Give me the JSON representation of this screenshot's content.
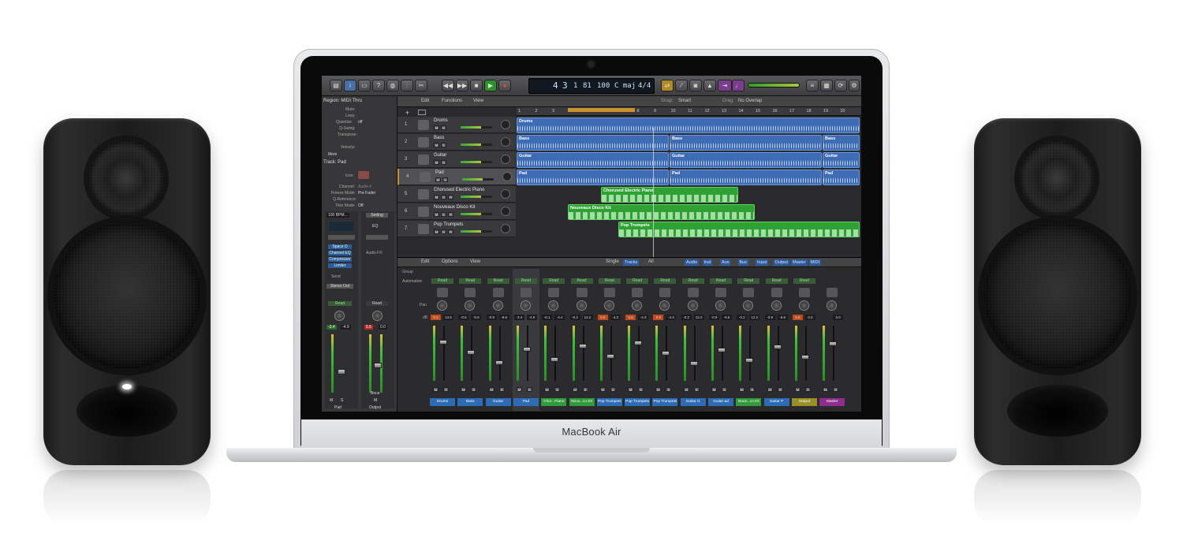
{
  "device": {
    "brand": "MacBook Air"
  },
  "app": {
    "lcd": {
      "bar": "4",
      "beat": "3",
      "div": "1",
      "tick": "81",
      "tempo": "100",
      "key": "C maj",
      "sig": "4/4"
    },
    "inspector": {
      "region_title": "Region: MIDI Thru",
      "rows": [
        "Mute:",
        "Loop:",
        "Quantize",
        "Q-Swing:",
        "Transpose:",
        "Velocity:"
      ],
      "quantize_value": "off",
      "more": "More",
      "track_title": "Track: Pad",
      "track_rows": [
        "Icon:",
        "Channel:",
        "Freeze Mode:",
        "Q-Reference:",
        "Flex Mode:"
      ],
      "channel_value": "Audio 4",
      "freeze_value": "Pre Fader",
      "flex_value": "Off",
      "tempo_label": "100 BPM...",
      "setting": "Setting",
      "eq": "EQ",
      "plugins": [
        "Space D",
        "Channel EQ",
        "Compressor",
        "Limiter"
      ],
      "audio_fx": "Audio FX",
      "send": "Send",
      "stereo_out": "Stereo Out",
      "read_a": "Read",
      "read_b": "Read",
      "vals_a": [
        "-3.4",
        "-4.9"
      ],
      "vals_b": [
        "5.5",
        "0.0"
      ],
      "bnce": "Bnce",
      "strip_names": [
        "Pad",
        "Output"
      ]
    },
    "tracks_toolbar": {
      "edit": "Edit",
      "functions": "Functions",
      "view": "View",
      "snap_label": "Snap:",
      "snap": "Smart",
      "drag_label": "Drag:",
      "drag": "No Overlap"
    },
    "ruler": [
      "1",
      "2",
      "3",
      "4",
      "5",
      "6",
      "7",
      "8",
      "9",
      "10",
      "11",
      "12",
      "13",
      "14",
      "15",
      "16",
      "17",
      "18",
      "19",
      "20"
    ],
    "tracks": [
      {
        "num": "1",
        "name": "Drums"
      },
      {
        "num": "2",
        "name": "Bass"
      },
      {
        "num": "3",
        "name": "Guitar"
      },
      {
        "num": "4",
        "name": "Pad"
      },
      {
        "num": "5",
        "name": "Chorused Electric Piano"
      },
      {
        "num": "6",
        "name": "Nouveaux Disco Kit"
      },
      {
        "num": "7",
        "name": "Pop Trumpets"
      }
    ],
    "ms": {
      "m": "M",
      "s": "S",
      "r": "R"
    },
    "regions": {
      "drums": "Drums",
      "bass": "Bass",
      "guitar": "Guitar",
      "pad": "Pad",
      "epiano": "Chorused Electric Piano",
      "disco": "Nouveaux Disco Kit",
      "trumpets": "Pop Trumpets"
    },
    "mixer_toolbar": {
      "edit": "Edit",
      "options": "Options",
      "view": "View",
      "single": "Single",
      "tracks": "Tracks",
      "all": "All",
      "filters": [
        "Audio",
        "Inst",
        "Aux",
        "Bus",
        "Input",
        "Output",
        "Master",
        "MIDI"
      ]
    },
    "mixer_labels": {
      "group": "Group",
      "automation": "Automation",
      "pan": "Pan",
      "db": "dB"
    },
    "channels": [
      {
        "name": "Drums",
        "read": "Read",
        "v1": "0.3",
        "v2": "13.6",
        "color": "#2d6db5"
      },
      {
        "name": "Bass",
        "read": "Read",
        "v1": "-0.6",
        "v2": "-5.8",
        "color": "#2d6db5"
      },
      {
        "name": "Guitar",
        "read": "Read",
        "v1": "-0.9",
        "v2": "-6.6",
        "color": "#2d6db5"
      },
      {
        "name": "Pad",
        "read": "Read",
        "v1": "-3.4",
        "v2": "-4.9",
        "color": "#2d6db5"
      },
      {
        "name": "Chor...Piano",
        "read": "Read",
        "v1": "-6.1",
        "v2": "-4.4",
        "color": "#2f9b3a"
      },
      {
        "name": "Nouv...co Kit",
        "read": "Read",
        "v1": "-0.2",
        "v2": "12.2",
        "color": "#2f9b3a"
      },
      {
        "name": "Pop Trumpets",
        "read": "Read",
        "v1": "0.6",
        "v2": "-4.3",
        "color": "#2d6db5"
      },
      {
        "name": "Pop Trumpets",
        "read": "Read",
        "v1": "5.6",
        "v2": "-4.3",
        "color": "#2d6db5"
      },
      {
        "name": "Pop Trumpets",
        "read": "Read",
        "v1": "0.6",
        "v2": "-4.3",
        "color": "#2d6db5"
      },
      {
        "name": "Guitar G",
        "read": "Read",
        "v1": "-0.2",
        "v2": "12.2",
        "color": "#2d6db5"
      },
      {
        "name": "Guitar ad",
        "read": "Read",
        "v1": "-0.9",
        "v2": "-6.6",
        "color": "#2d6db5"
      },
      {
        "name": "Nouv...co Kit",
        "read": "Read",
        "v1": "-0.2",
        "v2": "12.2",
        "color": "#2f9b3a"
      },
      {
        "name": "Guitar P",
        "read": "Read",
        "v1": "-0.9",
        "v2": "-6.6",
        "color": "#2d6db5"
      },
      {
        "name": "Output",
        "read": "Read",
        "v1": "5.5",
        "v2": "0.0",
        "color": "#9b8f2a"
      },
      {
        "name": "Master",
        "read": "",
        "v1": "",
        "v2": "0.0",
        "color": "#8e2d8e"
      }
    ],
    "bnce": "Bnce"
  }
}
